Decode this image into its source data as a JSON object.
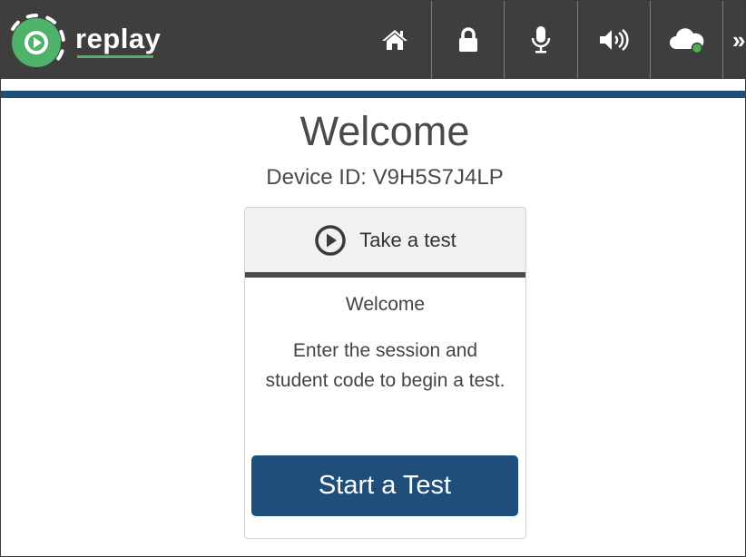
{
  "header": {
    "brand": "replay",
    "nav_buttons": [
      {
        "icon": "home-icon"
      },
      {
        "icon": "lock-icon"
      },
      {
        "icon": "microphone-icon"
      },
      {
        "icon": "volume-icon"
      },
      {
        "icon": "cloud-status-icon"
      },
      {
        "icon": "more-icon",
        "glyph": "»"
      }
    ]
  },
  "main": {
    "title": "Welcome",
    "device_id": "Device ID: V9H5S7J4LP"
  },
  "card": {
    "header_label": "Take a test",
    "header_icon": "play-circle-icon",
    "subtitle": "Welcome",
    "instructions": "Enter the session and student code to begin a test.",
    "button_label": "Start a Test"
  },
  "colors": {
    "topbar": "#3e3e3e",
    "accent_blue": "#1f4e7a",
    "brand_green": "#4fb26a",
    "cloud_status_green": "#4caf50"
  }
}
